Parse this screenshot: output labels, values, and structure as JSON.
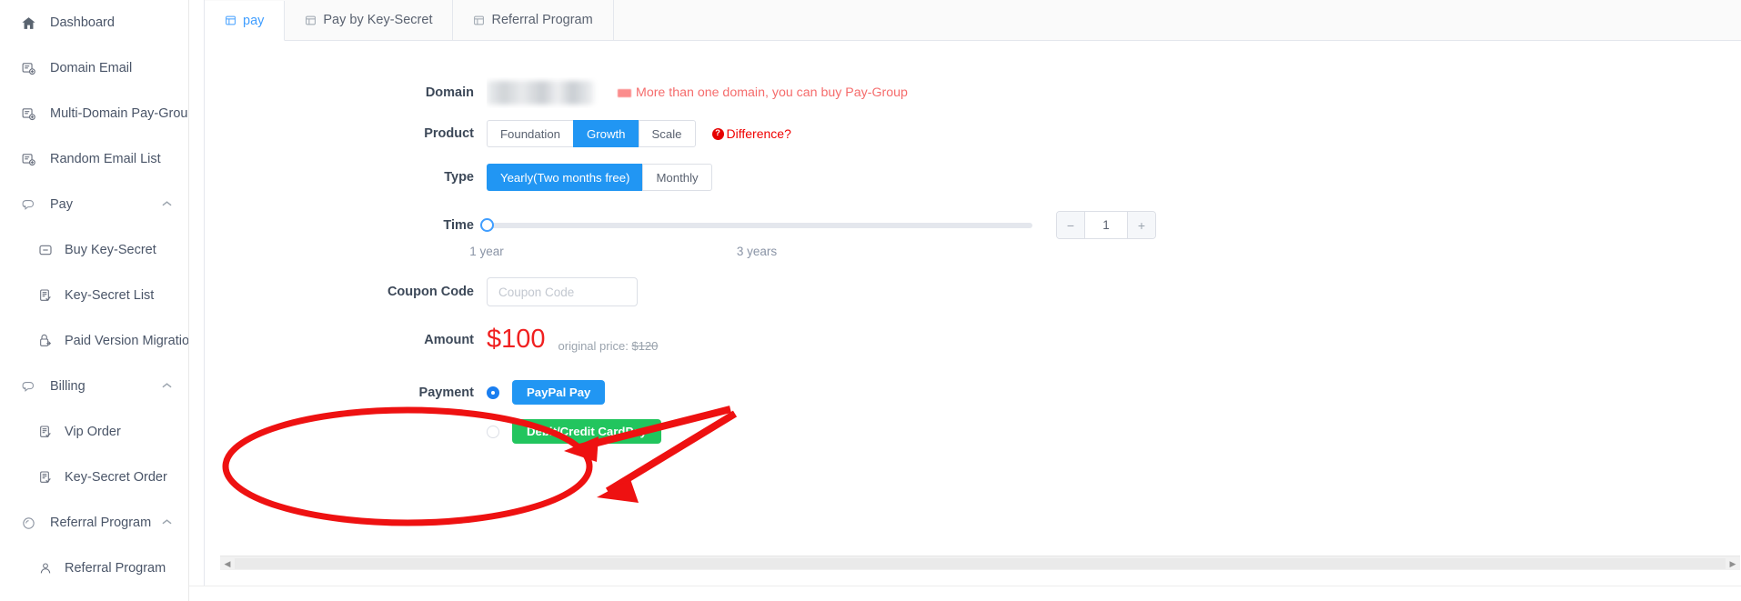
{
  "sidebar": {
    "items": [
      {
        "label": "Dashboard",
        "icon": "home-icon",
        "level": "top",
        "expandable": false
      },
      {
        "label": "Domain Email",
        "icon": "domain-email-icon",
        "level": "top",
        "expandable": false
      },
      {
        "label": "Multi-Domain Pay-Group",
        "icon": "multi-domain-icon",
        "level": "top",
        "expandable": false
      },
      {
        "label": "Random Email List",
        "icon": "random-email-icon",
        "level": "top",
        "expandable": false
      },
      {
        "label": "Pay",
        "icon": "pay-icon",
        "level": "top",
        "expandable": true,
        "chevron": "chevron-up-icon"
      },
      {
        "label": "Buy Key-Secret",
        "icon": "buy-key-secret-icon",
        "level": "sub",
        "expandable": false
      },
      {
        "label": "Key-Secret List",
        "icon": "key-secret-list-icon",
        "level": "sub",
        "expandable": false
      },
      {
        "label": "Paid Version Migration",
        "icon": "migration-icon",
        "level": "sub",
        "expandable": false
      },
      {
        "label": "Billing",
        "icon": "billing-icon",
        "level": "top",
        "expandable": true,
        "chevron": "chevron-up-icon"
      },
      {
        "label": "Vip Order",
        "icon": "vip-order-icon",
        "level": "sub",
        "expandable": false
      },
      {
        "label": "Key-Secret Order",
        "icon": "key-secret-order-icon",
        "level": "sub",
        "expandable": false
      },
      {
        "label": "Referral Program",
        "icon": "referral-icon",
        "level": "top",
        "expandable": true,
        "chevron": "chevron-up-icon"
      },
      {
        "label": "Referral Program",
        "icon": "referral-sub-icon",
        "level": "sub",
        "expandable": false
      }
    ]
  },
  "tabs": [
    {
      "label": "pay",
      "icon": "table-icon",
      "active": true
    },
    {
      "label": "Pay by Key-Secret",
      "icon": "table-icon",
      "active": false
    },
    {
      "label": "Referral Program",
      "icon": "table-icon",
      "active": false
    }
  ],
  "form": {
    "domain": {
      "label": "Domain",
      "value": "",
      "redacted": true,
      "hint": "More than one domain, you can buy Pay-Group"
    },
    "product": {
      "label": "Product",
      "options": [
        "Foundation",
        "Growth",
        "Scale"
      ],
      "selected": "Growth",
      "difference_link": "Difference?"
    },
    "type": {
      "label": "Type",
      "options": [
        "Yearly(Two months free)",
        "Monthly"
      ],
      "selected": "Yearly(Two months free)"
    },
    "time": {
      "label": "Time",
      "value": 1,
      "min_label": "1 year",
      "max_label": "3 years",
      "stepper_value": "1",
      "minus_label": "−",
      "plus_label": "+"
    },
    "coupon": {
      "label": "Coupon Code",
      "placeholder": "Coupon Code",
      "value": ""
    },
    "amount": {
      "label": "Amount",
      "price": "$100",
      "original_prefix": "original price:",
      "original_price": "$120"
    },
    "payment": {
      "label": "Payment",
      "options": [
        {
          "label": "PayPal Pay",
          "selected": true,
          "color": "#2196f3"
        },
        {
          "label": "Debit/Credit CardPay",
          "selected": false,
          "color": "#22c55e"
        }
      ]
    }
  },
  "annotations": {
    "ellipse": "red-ellipse-highlight",
    "arrow_1": "red-arrow-to-paypal",
    "arrow_2": "red-arrow-to-cardpay",
    "color": "#ee1111"
  },
  "scrollbar": {
    "left_arrow": "◀",
    "right_arrow": "▶"
  },
  "colors": {
    "accent_blue": "#2196f3",
    "link_blue": "#409eff",
    "danger_red": "#f02020",
    "success_green": "#22c55e"
  }
}
